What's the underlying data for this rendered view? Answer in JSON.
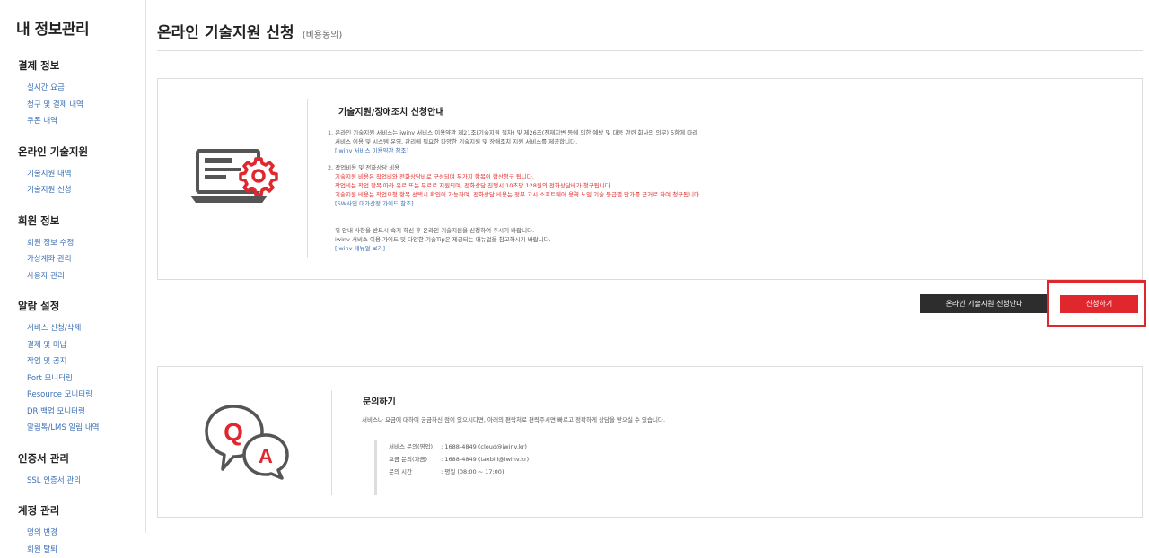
{
  "sidebar": {
    "title": "내 정보관리",
    "sections": [
      {
        "heading": "결제 정보",
        "items": [
          "실시간 요금",
          "청구 및 결제 내역",
          "쿠폰 내역"
        ]
      },
      {
        "heading": "온라인 기술지원",
        "items": [
          "기술지원 내역",
          "기술지원 신청"
        ]
      },
      {
        "heading": "회원 정보",
        "items": [
          "회원 정보 수정",
          "가상계좌 관리",
          "사용자 관리"
        ]
      },
      {
        "heading": "알람 설정",
        "items": [
          "서비스 신청/삭제",
          "결제 및 미납",
          "작업 및 공지",
          "Port 모니터링",
          "Resource 모니터링",
          "DR 백업 모니터링",
          "알림톡/LMS 알림 내역"
        ]
      },
      {
        "heading": "인증서 관리",
        "items": [
          "SSL 인증서 관리"
        ]
      },
      {
        "heading": "계정 관리",
        "items": [
          "명의 변경",
          "회원 탈퇴"
        ]
      }
    ]
  },
  "header": {
    "title": "온라인 기술지원 신청",
    "subtitle": "(비용동의)"
  },
  "info_panel": {
    "title": "기술지원/장애조치 신청안내",
    "p1_line1": "1. 온라인 기술지원 서비스는 iwinv 서비스 이용약관 제21조(기술지원 절차) 및 제26조(천재지변 등에 의한 예방 및 대응 관련 회사의 의무) 5항에 따라",
    "p1_line2": "서비스 이용 및 시스템 운영, 관리에 필요한 다양한 기술지원 및 장애조치 지원 서비스를 제공합니다.",
    "p1_link": "[iwinv 서비스 이용약관 참조]",
    "p2_line1": "2. 작업비용 및 전화상담 비용",
    "p2_red1": "기술지원 비용은 작업비와 전화상담비로 구성되며 두가지 항목이 합산청구 됩니다.",
    "p2_red2": "작업비는 작업 항목 따라 유료 또는 무료로 지원되며, 전화상담 진행시 10초당 128원의 전화상담비가 청구됩니다.",
    "p2_red3": "기술지원 비용는 작업요청 항목 선택시 확인이 가능하며, 전화상담 비용는 정부 고시 소프트웨어 용역 노임 기술 등급별 단가를 근거로 하여 청구됩니다.",
    "p2_link": "[SW사업 대가산정 가이드 참조]",
    "p3_line1": "위 안내 사항을 반드시 숙지 하신 후 온라인 기술지원을 신청하여 주시기 바랍니다.",
    "p3_line2": "iwinv 서비스 이용 가이드 및 다양한 기술Tip은 제공되는 매뉴얼을 참고하시기 바랍니다.",
    "p3_link": "[iwinv 메뉴얼 보기]"
  },
  "buttons": {
    "guide": "온라인 기술지원 신청안내",
    "apply": "신청하기"
  },
  "qa_panel": {
    "title": "문의하기",
    "desc": "서비스나 요금에 대하여 궁금하신 점이 있으시다면, 아래의 편락처로 편락주시면 빠르고 정확하게 상담을 받으실 수 있습니다.",
    "rows": [
      {
        "label": "서비스 문의(영업)",
        "value": ": 1688-4849 (cloud@iwinv.kr)"
      },
      {
        "label": "요금 문의(과금)",
        "value": ": 1688-4849 (taxbill@iwinv.kr)"
      },
      {
        "label": "문의 시간",
        "value": ": 평일 (08:00 ~ 17:00)"
      }
    ],
    "icon_q": "Q",
    "icon_a": "A"
  },
  "colors": {
    "accent_red": "#e0272d",
    "link_blue": "#3b6fb5",
    "dark_button": "#2d2d2d"
  },
  "icons": [
    "laptop-gear-icon",
    "qa-bubbles-icon"
  ]
}
